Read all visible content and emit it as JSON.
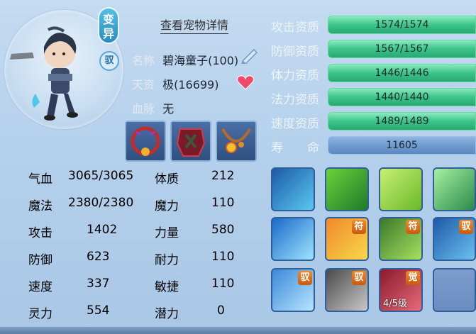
{
  "pet": {
    "view_detail": "查看宠物详情",
    "bianyi": "变异",
    "yu": "驭",
    "name_label": "名称",
    "name_value": "碧海童子(100)",
    "aptitude_label": "天资",
    "aptitude_value": "极(16699)",
    "bloodline_label": "血脉",
    "bloodline_value": "无"
  },
  "equipment": [
    {
      "name": "collar-icon"
    },
    {
      "name": "armor-icon"
    },
    {
      "name": "necklace-icon"
    }
  ],
  "attributes": [
    {
      "k": "气血",
      "v": "3065/3065",
      "k2": "体质",
      "v2": "212"
    },
    {
      "k": "魔法",
      "v": "2380/2380",
      "k2": "魔力",
      "v2": "110"
    },
    {
      "k": "攻击",
      "v": "1402",
      "k2": "力量",
      "v2": "580"
    },
    {
      "k": "防御",
      "v": "623",
      "k2": "耐力",
      "v2": "110"
    },
    {
      "k": "速度",
      "v": "337",
      "k2": "敏捷",
      "v2": "110"
    },
    {
      "k": "灵力",
      "v": "554",
      "k2": "潜力",
      "v2": "0"
    }
  ],
  "qualities": [
    {
      "label": "攻击资质",
      "value": "1574/1574"
    },
    {
      "label": "防御资质",
      "value": "1567/1567"
    },
    {
      "label": "体力资质",
      "value": "1446/1446"
    },
    {
      "label": "法力资质",
      "value": "1440/1440"
    },
    {
      "label": "速度资质",
      "value": "1489/1489"
    },
    {
      "label": "寿　　命",
      "value": "11605"
    }
  ],
  "skills": [
    {
      "name": "blood-drain-skill-icon",
      "tag": "",
      "level": ""
    },
    {
      "name": "strength-skill-icon",
      "tag": "",
      "level": ""
    },
    {
      "name": "heart-skill-icon",
      "tag": "",
      "level": ""
    },
    {
      "name": "burst-skill-icon",
      "tag": "",
      "level": ""
    },
    {
      "name": "water-skill-icon",
      "tag": "",
      "level": ""
    },
    {
      "name": "talisman-skill-icon",
      "tag": "符",
      "level": ""
    },
    {
      "name": "talisman-strength-skill-icon",
      "tag": "符",
      "level": ""
    },
    {
      "name": "wolf-skill-icon",
      "tag": "驭",
      "level": ""
    },
    {
      "name": "shield-skill-icon",
      "tag": "驭",
      "level": ""
    },
    {
      "name": "blade-skill-icon",
      "tag": "驭",
      "level": ""
    },
    {
      "name": "awaken-skill-icon",
      "tag": "觉",
      "level": "4/5级"
    },
    {
      "name": "empty-skill-slot",
      "tag": "",
      "level": ""
    }
  ]
}
